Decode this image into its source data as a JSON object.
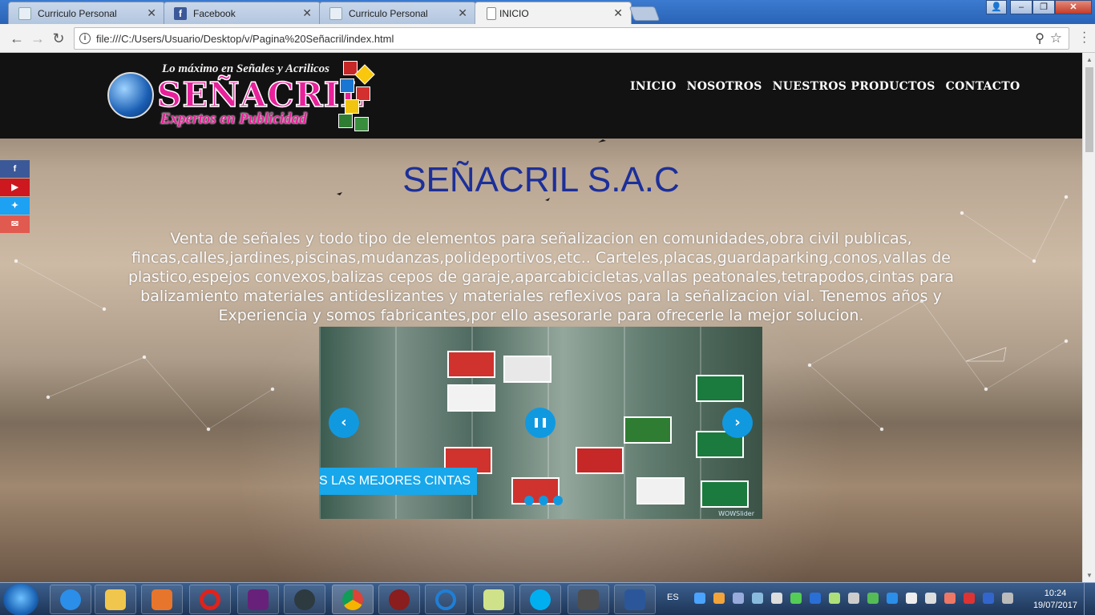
{
  "browser": {
    "tabs": [
      {
        "title": "Curriculo Personal",
        "icon": "page-icon",
        "active": false
      },
      {
        "title": "Facebook",
        "icon": "facebook-icon",
        "active": false
      },
      {
        "title": "Curriculo Personal",
        "icon": "page-icon",
        "active": false
      },
      {
        "title": "INICIO",
        "icon": "file-icon",
        "active": true
      }
    ],
    "url": "file:///C:/Users/Usuario/Desktop/v/Pagina%20Señacril/index.html"
  },
  "site": {
    "logo": {
      "tagline": "Lo máximo en Señales y Acrilicos",
      "brand": "SEÑACRIL",
      "sub": "Expertos en Publicidad"
    },
    "nav": [
      "INICIO",
      "NOSOTROS",
      "NUESTROS PRODUCTOS",
      "CONTACTO"
    ],
    "social": [
      {
        "icon": "facebook-icon",
        "glyph": "f",
        "color": "#3b5998"
      },
      {
        "icon": "youtube-icon",
        "glyph": "▶",
        "color": "#cc181e"
      },
      {
        "icon": "twitter-icon",
        "glyph": "🐦",
        "color": "#1da1f2"
      },
      {
        "icon": "email-icon",
        "glyph": "✉",
        "color": "#e05a4f"
      }
    ],
    "headline": "SEÑACRIL S.A.C",
    "intro": "Venta de señales y todo tipo de elementos para señalizacion en comunidades,obra civil publicas, fincas,calles,jardines,piscinas,mudanzas,polideportivos,etc.. Carteles,placas,guardaparking,conos,vallas de plastico,espejos convexos,balizas cepos de garaje,aparcabicicletas,vallas peatonales,tetrapodos,cintas para balizamiento materiales antideslizantes y materiales reflexivos para la señalizacion vial. Tenemos años y Experiencia y somos fabricantes,por ello asesorarle para ofrecerle la mejor solucion.",
    "slider": {
      "caption": "S LAS MEJORES CINTAS",
      "prev": "‹",
      "pause": "❚❚",
      "next": "›",
      "dots": 3,
      "watermark": "WOWSlider"
    }
  },
  "taskbar": {
    "apps": [
      "internet-explorer-icon",
      "file-explorer-icon",
      "media-player-icon",
      "opera-icon",
      "visual-studio-icon",
      "nox-icon",
      "chrome-icon",
      "game-icon",
      "ccleaner-icon",
      "folder-icon",
      "skype-icon",
      "sublime-icon",
      "word-icon"
    ],
    "language": "ES",
    "time": "10:24",
    "date": "19/07/2017"
  }
}
